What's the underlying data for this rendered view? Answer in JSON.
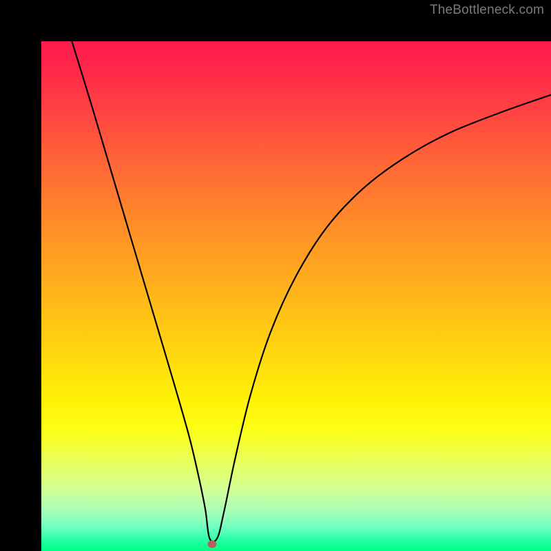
{
  "watermark": "TheBottleneck.com",
  "marker": {
    "x_frac": 0.335,
    "y_frac": 0.986
  },
  "chart_data": {
    "type": "line",
    "title": "",
    "xlabel": "",
    "ylabel": "",
    "xlim": [
      0,
      1
    ],
    "ylim": [
      0,
      1
    ],
    "series": [
      {
        "name": "bottleneck-curve",
        "x": [
          0.06,
          0.1,
          0.14,
          0.18,
          0.22,
          0.26,
          0.29,
          0.31,
          0.322,
          0.33,
          0.345,
          0.358,
          0.38,
          0.41,
          0.45,
          0.5,
          0.56,
          0.63,
          0.71,
          0.8,
          0.9,
          1.0
        ],
        "y": [
          1.0,
          0.87,
          0.735,
          0.6,
          0.465,
          0.33,
          0.225,
          0.14,
          0.08,
          0.025,
          0.025,
          0.075,
          0.18,
          0.305,
          0.43,
          0.54,
          0.635,
          0.71,
          0.77,
          0.82,
          0.86,
          0.895
        ]
      }
    ],
    "background_gradient": {
      "top": "#ff1a4d",
      "mid": "#ffd000",
      "bottom": "#00ff88"
    }
  }
}
